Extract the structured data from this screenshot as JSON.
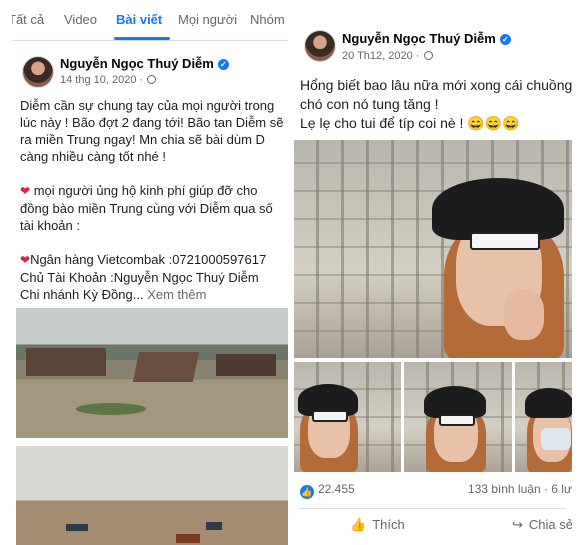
{
  "left_post": {
    "tabs": [
      "Tất cả",
      "Video",
      "Bài viết",
      "Mọi người",
      "Nhóm"
    ],
    "active_tab": "Bài viết",
    "author": "Nguyễn Ngọc Thuý Diễm",
    "date": "14 thg 10, 2020 ·",
    "lines": [
      "Diễm cần sự chung tay của mọi người trong",
      "lúc này ! Bão đợt 2 đang tới! Bão tan Diễm sẽ",
      "ra miền Trung ngay! Mn chia sẽ bài dùm D",
      "càng nhiều càng tốt nhé !"
    ],
    "donate_lines": [
      "mọi người ủng hộ kinh phí giúp đỡ cho",
      "đồng bào miền Trung cùng với Diễm qua số",
      "tài khoản :"
    ],
    "bank_line": "Ngân hàng Vietcombak :0721000597617",
    "holder_line": "Chủ Tài Khoản :Nguyễn Ngọc Thuý Diễm",
    "branch_line": "Chi nhánh Kỳ Đồng...",
    "see_more": "Xem thêm"
  },
  "right_post": {
    "author": "Nguyễn Ngọc Thuý Diễm",
    "date": "20 Th12, 2020 ·",
    "lines": [
      "Hổng biết bao lâu nữa mới xong cái chuồng",
      "chó con nó tung tăng !",
      "Lẹ lẹ cho tui để típ coi nè ! 😄😄😄"
    ],
    "reaction_count": "22.455",
    "comments": "133 bình luận · 6 lư",
    "like_label": "Thích",
    "share_label": "Chia sẻ"
  }
}
